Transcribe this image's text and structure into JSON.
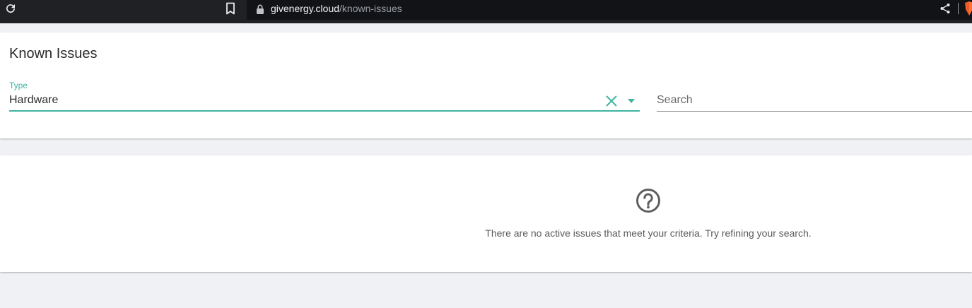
{
  "browser": {
    "url_host": "givenergy.cloud",
    "url_path": "/known-issues",
    "icons": [
      "reload-icon",
      "bookmark-icon",
      "lock-icon",
      "share-icon",
      "brave-lion-icon"
    ]
  },
  "page": {
    "title": "Known Issues"
  },
  "filters": {
    "type_label": "Type",
    "type_value": "Hardware",
    "search_placeholder": "Search",
    "search_value": ""
  },
  "results": {
    "empty_icon": "question-circle-icon",
    "empty_message": "There are no active issues that meet your criteria. Try refining your search."
  },
  "colors": {
    "accent": "#3fb5a2",
    "chrome_bg": "#202124",
    "page_bg": "#f0f1f4"
  }
}
